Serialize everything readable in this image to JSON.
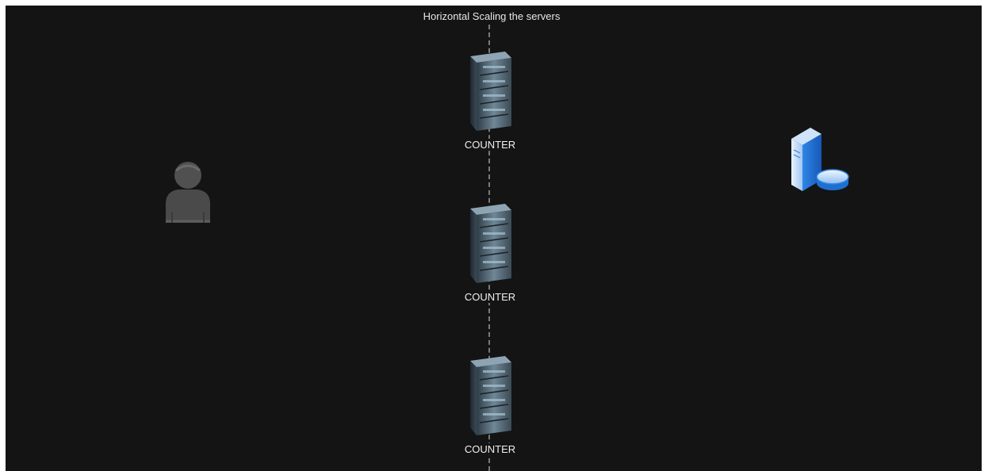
{
  "diagram": {
    "title": "Horizontal Scaling the servers",
    "servers": [
      {
        "label": "COUNTER",
        "icon": "server-rack-icon"
      },
      {
        "label": "COUNTER",
        "icon": "server-rack-icon"
      },
      {
        "label": "COUNTER",
        "icon": "server-rack-icon"
      }
    ],
    "client": {
      "icon": "user-icon"
    },
    "database": {
      "icon": "database-server-icon"
    }
  },
  "colors": {
    "background": "#141414",
    "text": "#f0f0f0",
    "divider": "#7a7a7a",
    "db_blue": "#2f86e6"
  }
}
